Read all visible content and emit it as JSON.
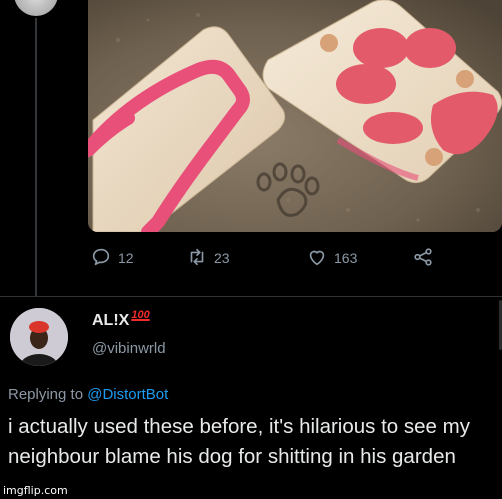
{
  "thread": {
    "actions": {
      "reply_count": "12",
      "retweet_count": "23",
      "like_count": "163"
    }
  },
  "reply": {
    "display_name": "AL!X",
    "name_badge": "100",
    "handle": "@vibinwrld",
    "replying_to_prefix": "Replying to",
    "replying_to_handle": "@DistortBot",
    "text": "i actually used these before, it's hilarious to see my neighbour blame his dog for shitting in his garden"
  },
  "watermark": "imgflip.com",
  "colors": {
    "background": "#000000",
    "text": "#e7e9ea",
    "muted": "#8b98a5",
    "link": "#1d9bf0",
    "badge": "#f02c2c",
    "sandal_strap": "#e8507a",
    "paw_pads": "#e35a6b"
  },
  "icons": [
    "reply-icon",
    "retweet-icon",
    "like-icon",
    "share-icon"
  ]
}
